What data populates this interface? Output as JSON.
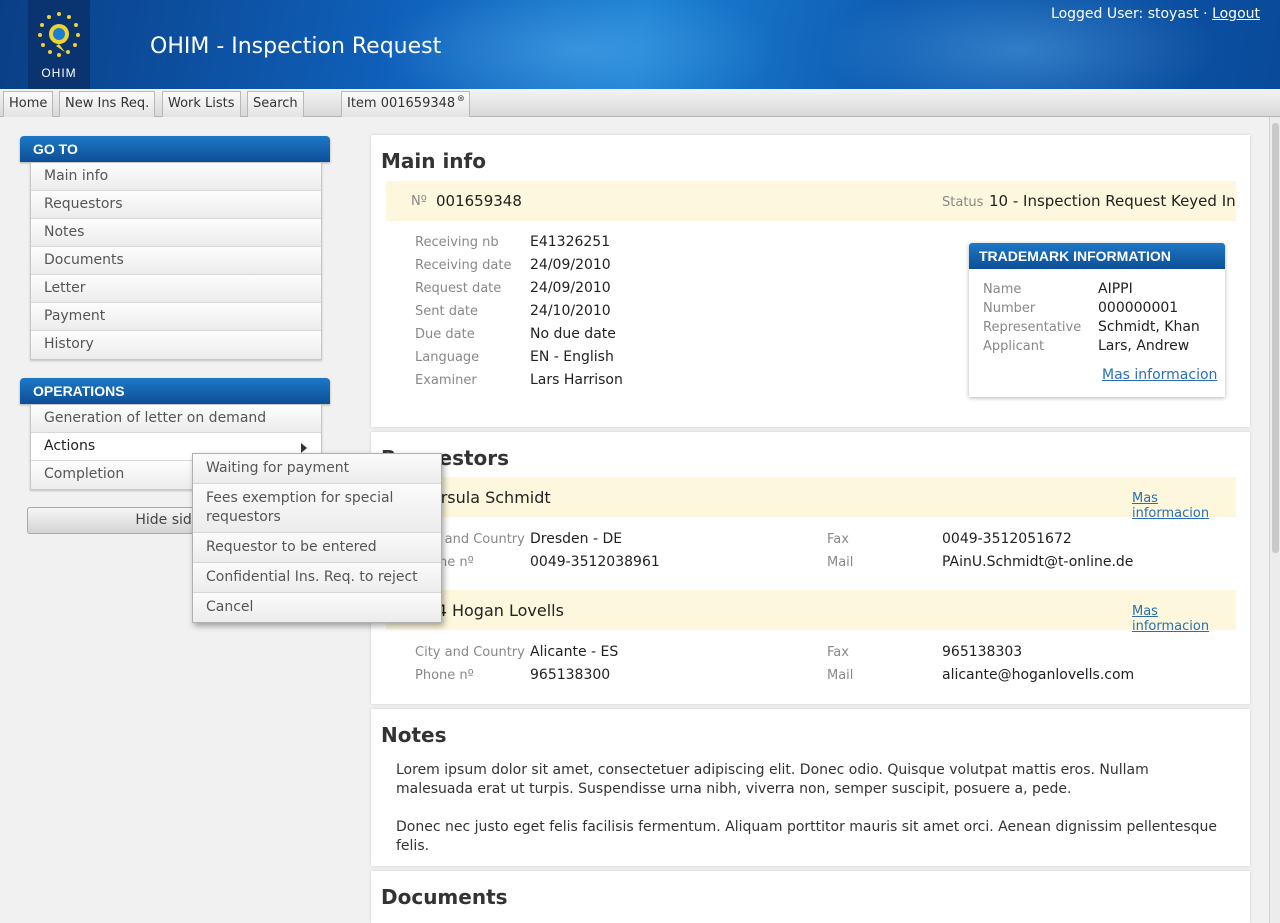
{
  "header": {
    "logo_text": "OHIM",
    "title": "OHIM - Inspection Request",
    "logged_user_label": "Logged User: stoyast ·",
    "logout_label": "Logout"
  },
  "nav": {
    "home": "Home",
    "new_ins_req": "New Ins Req.",
    "work_lists": "Work Lists",
    "search": "Search",
    "item_tab": "Item 001659348",
    "item_tab_close": "⊗"
  },
  "sidebar": {
    "goto_title": "GO TO",
    "goto_items": [
      "Main info",
      "Requestors",
      "Notes",
      "Documents",
      "Letter",
      "Payment",
      "History"
    ],
    "operations_title": "OPERATIONS",
    "operations_items": [
      "Generation of letter on demand",
      "Actions",
      "Completion"
    ],
    "hide_button": "Hide sidebar"
  },
  "actions_submenu": [
    "Waiting for payment",
    "Fees exemption for special requestors",
    "Requestor to be entered",
    "Confidential Ins. Req. to reject",
    "Cancel"
  ],
  "main_info": {
    "title": "Main info",
    "number_label": "Nº",
    "number": "001659348",
    "status_label": "Status",
    "status": "10 - Inspection Request Keyed In",
    "fields": [
      {
        "label": "Receiving nb",
        "value": "E41326251"
      },
      {
        "label": "Receiving date",
        "value": "24/09/2010"
      },
      {
        "label": "Request date",
        "value": "24/09/2010"
      },
      {
        "label": "Sent date",
        "value": "24/10/2010"
      },
      {
        "label": "Due date",
        "value": "No due date"
      },
      {
        "label": "Language",
        "value": "EN - English"
      },
      {
        "label": "Examiner",
        "value": "Lars Harrison"
      }
    ],
    "trademark": {
      "title": "TRADEMARK INFORMATION",
      "fields": [
        {
          "label": "Name",
          "value": "AIPPI"
        },
        {
          "label": "Number",
          "value": "000000001"
        },
        {
          "label": "Representative",
          "value": "Schmidt, Khan"
        },
        {
          "label": "Applicant",
          "value": "Lars, Andrew"
        }
      ],
      "link": "Mas informacion"
    }
  },
  "requestors": {
    "title": "Requestors",
    "items": [
      {
        "name": "Ursula Schmidt",
        "link": "Mas informacion",
        "city_label": "City and Country",
        "city": "Dresden - DE",
        "phone_label": "Phone nº",
        "phone": "0049-3512038961",
        "fax_label": "Fax",
        "fax": "0049-3512051672",
        "mail_label": "Mail",
        "mail": "PAinU.Schmidt@t-online.de"
      },
      {
        "name": "10014 Hogan Lovells",
        "link": "Mas informacion",
        "city_label": "City and Country",
        "city": "Alicante - ES",
        "phone_label": "Phone nº",
        "phone": "965138300",
        "fax_label": "Fax",
        "fax": "965138303",
        "mail_label": "Mail",
        "mail": "alicante@hoganlovells.com"
      }
    ]
  },
  "notes": {
    "title": "Notes",
    "paragraphs": [
      "Lorem ipsum dolor sit amet, consectetuer adipiscing elit. Donec odio. Quisque volutpat mattis eros. Nullam malesuada erat ut turpis. Suspendisse urna nibh, viverra non, semper suscipit, posuere a, pede.",
      "Donec nec justo eget felis facilisis fermentum. Aliquam porttitor mauris sit amet orci. Aenean dignissim pellentesque felis."
    ]
  },
  "documents": {
    "title": "Documents"
  }
}
